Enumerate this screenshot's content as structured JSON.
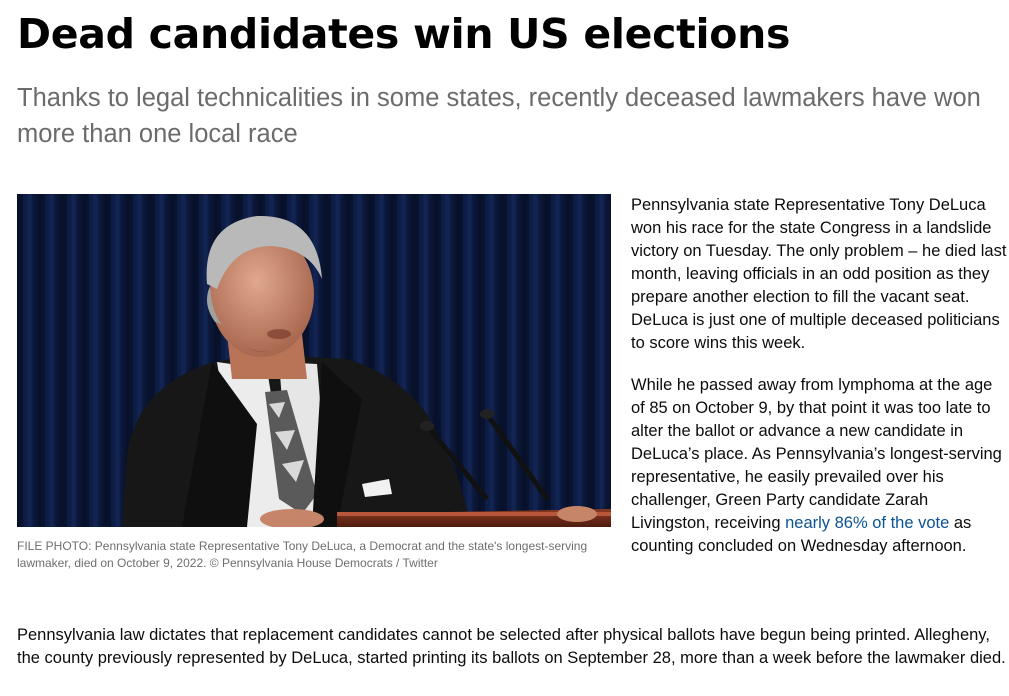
{
  "article": {
    "headline": "Dead candidates win US elections",
    "subheadline": "Thanks to legal technicalities in some states, recently deceased lawmakers have won more than one local race",
    "photo": {
      "icon": "photo-of-man-speaking-at-podium",
      "caption": "FILE PHOTO: Pennsylvania state Representative Tony DeLuca, a Democrat and the state's longest-serving lawmaker, died on October 9, 2022. ©  Pennsylvania House Democrats / Twitter"
    },
    "paragraph1": "Pennsylvania state Representative Tony DeLuca won his race for the state Congress in a landslide victory on Tuesday. The only problem – he died last month, leaving officials in an odd position as they prepare another election to fill the vacant seat. DeLuca is just one of multiple deceased politicians to score wins this week.",
    "paragraph2": {
      "before": "While he passed away from lymphoma at the age of 85 on October 9, by that point it was too late to alter the ballot or advance a new candidate in DeLuca’s place. As Pennsylvania’s longest-serving representative, he easily prevailed over his challenger, Green Party candidate Zarah Livingston, receiving ",
      "link": "nearly 86% of the vote",
      "after": " as counting concluded on Wednesday afternoon."
    },
    "paragraph3": "Pennsylvania law dictates that replacement candidates cannot be selected after physical ballots have begun being printed. Allegheny, the county previously represented by DeLuca, started printing its ballots on September 28, more than a week before the lawmaker died."
  },
  "colors": {
    "link": "#0c5394",
    "subhead": "#6b6b6b",
    "caption": "#6e6e6e"
  }
}
